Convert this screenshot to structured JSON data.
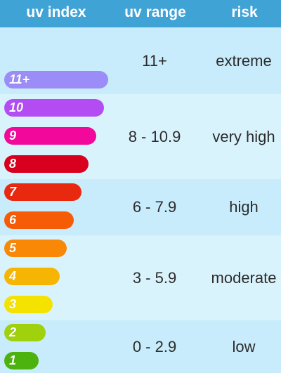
{
  "header": {
    "col1": "uv index",
    "col2": "uv range",
    "col3": "risk"
  },
  "bands": [
    {
      "range": "11+",
      "risk": "extreme",
      "color": "#c8ecfb"
    },
    {
      "range": "8 - 10.9",
      "risk": "very high",
      "color": "#d9f3fd"
    },
    {
      "range": "6 - 7.9",
      "risk": "high",
      "color": "#c8ecfb"
    },
    {
      "range": "3 - 5.9",
      "risk": "moderate",
      "color": "#d9f3fd"
    },
    {
      "range": "0 - 2.9",
      "risk": "low",
      "color": "#c8ecfb"
    }
  ],
  "bars": [
    {
      "label": "11+",
      "color": "#9b8cf7"
    },
    {
      "label": "10",
      "color": "#b44cf4"
    },
    {
      "label": "9",
      "color": "#f2089b"
    },
    {
      "label": "8",
      "color": "#d9001e"
    },
    {
      "label": "7",
      "color": "#e8290f"
    },
    {
      "label": "6",
      "color": "#f65c06"
    },
    {
      "label": "5",
      "color": "#f88805"
    },
    {
      "label": "4",
      "color": "#f7b503"
    },
    {
      "label": "3",
      "color": "#f4e300"
    },
    {
      "label": "2",
      "color": "#9fd10d"
    },
    {
      "label": "1",
      "color": "#4cb30e"
    }
  ]
}
